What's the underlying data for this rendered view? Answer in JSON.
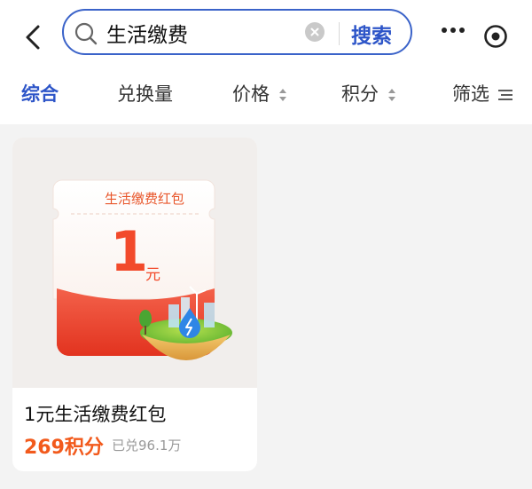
{
  "header": {
    "search": {
      "value": "生活缴费",
      "button_label": "搜索"
    },
    "icons": [
      "back-arrow",
      "search",
      "clear",
      "more-dots",
      "target"
    ]
  },
  "tabs": [
    {
      "label": "综合",
      "active": true
    },
    {
      "label": "兑换量",
      "active": false
    },
    {
      "label": "价格",
      "active": false,
      "sortable": true
    },
    {
      "label": "积分",
      "active": false,
      "sortable": true
    },
    {
      "label": "筛选",
      "active": false,
      "icon": "filter-lines"
    }
  ],
  "products": [
    {
      "coupon_title": "生活缴费红包",
      "coupon_amount": "1",
      "coupon_unit": "元",
      "title": "1元生活缴费红包",
      "points": "269积分",
      "redeemed": "已兑96.1万"
    }
  ],
  "colors": {
    "accent": "#2d55c8",
    "price": "#f25a1c",
    "background": "#f3f3f3"
  }
}
